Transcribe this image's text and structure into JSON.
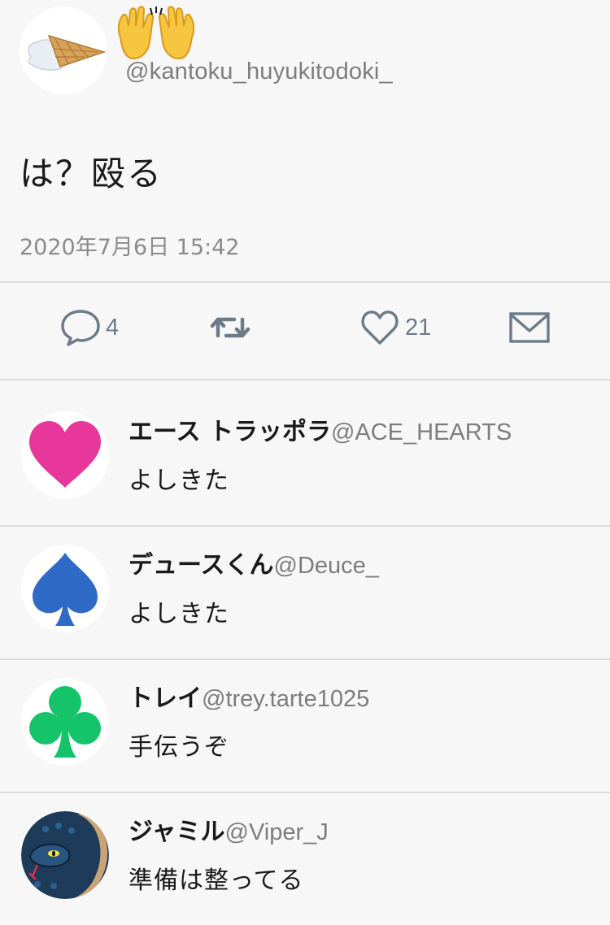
{
  "tweet": {
    "handle": "@kantoku_huyukitodoki_",
    "text": "は？殴る",
    "timestamp": "2020年7月6日 15:42"
  },
  "actions": {
    "reply_count": "4",
    "like_count": "21"
  },
  "replies": [
    {
      "name": "エース トラッポラ",
      "handle": "@ACE_HEARTS",
      "text": "よしきた",
      "avatar_icon": "heart-icon",
      "color": "#e8379a"
    },
    {
      "name": "デュースくん",
      "handle": "@Deuce_",
      "text": "よしきた",
      "avatar_icon": "spade-icon",
      "color": "#2f6bc6"
    },
    {
      "name": "トレイ",
      "handle": "@trey.tarte1025",
      "text": "手伝うぞ",
      "avatar_icon": "club-icon",
      "color": "#15c46a"
    },
    {
      "name": "ジャミル",
      "handle": "@Viper_J",
      "text": "準備は整ってる",
      "avatar_icon": "snake-icon",
      "color": "#1e3c5a"
    }
  ],
  "colors": {
    "background": "#f7f7f7",
    "divider": "#dcdcdc",
    "icon": "#6b7b8a",
    "muted_text": "#7d7d7d"
  }
}
